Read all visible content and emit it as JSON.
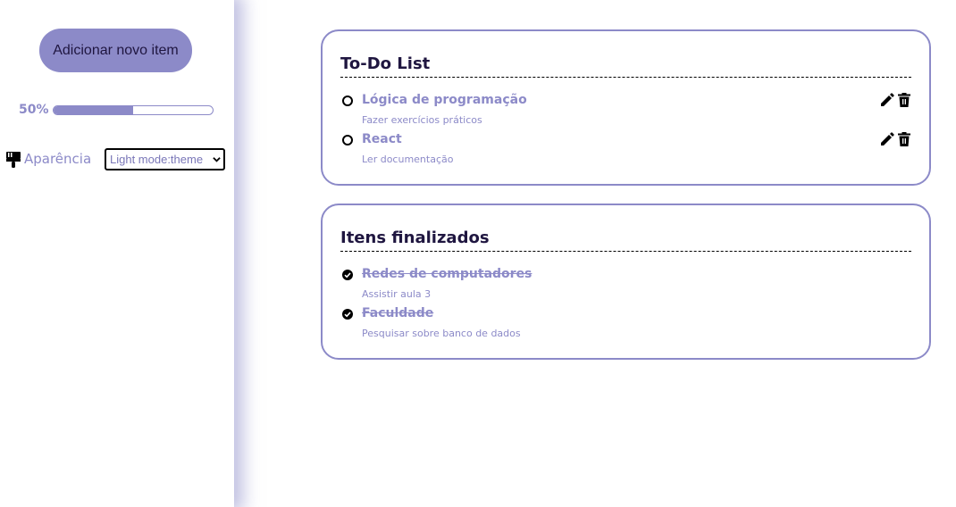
{
  "sidebar": {
    "add_button_label": "Adicionar novo item",
    "progress": {
      "label": "50%",
      "value": 0.5
    },
    "appearance": {
      "icon": "paint-brush-icon",
      "label": "Aparência",
      "selected_option": "Light mode:theme"
    }
  },
  "todo": {
    "title": "To-Do List",
    "items": [
      {
        "title": "Lógica de programação",
        "description": "Fazer exercícios práticos"
      },
      {
        "title": "React",
        "description": "Ler documentação"
      }
    ]
  },
  "done": {
    "title": "Itens finalizados",
    "items": [
      {
        "title": "Redes de computadores",
        "description": "Assistir aula 3"
      },
      {
        "title": "Faculdade",
        "description": "Pesquisar sobre banco de dados"
      }
    ]
  },
  "colors": {
    "accent": "#8c8ac8",
    "heading": "#1f1640"
  }
}
